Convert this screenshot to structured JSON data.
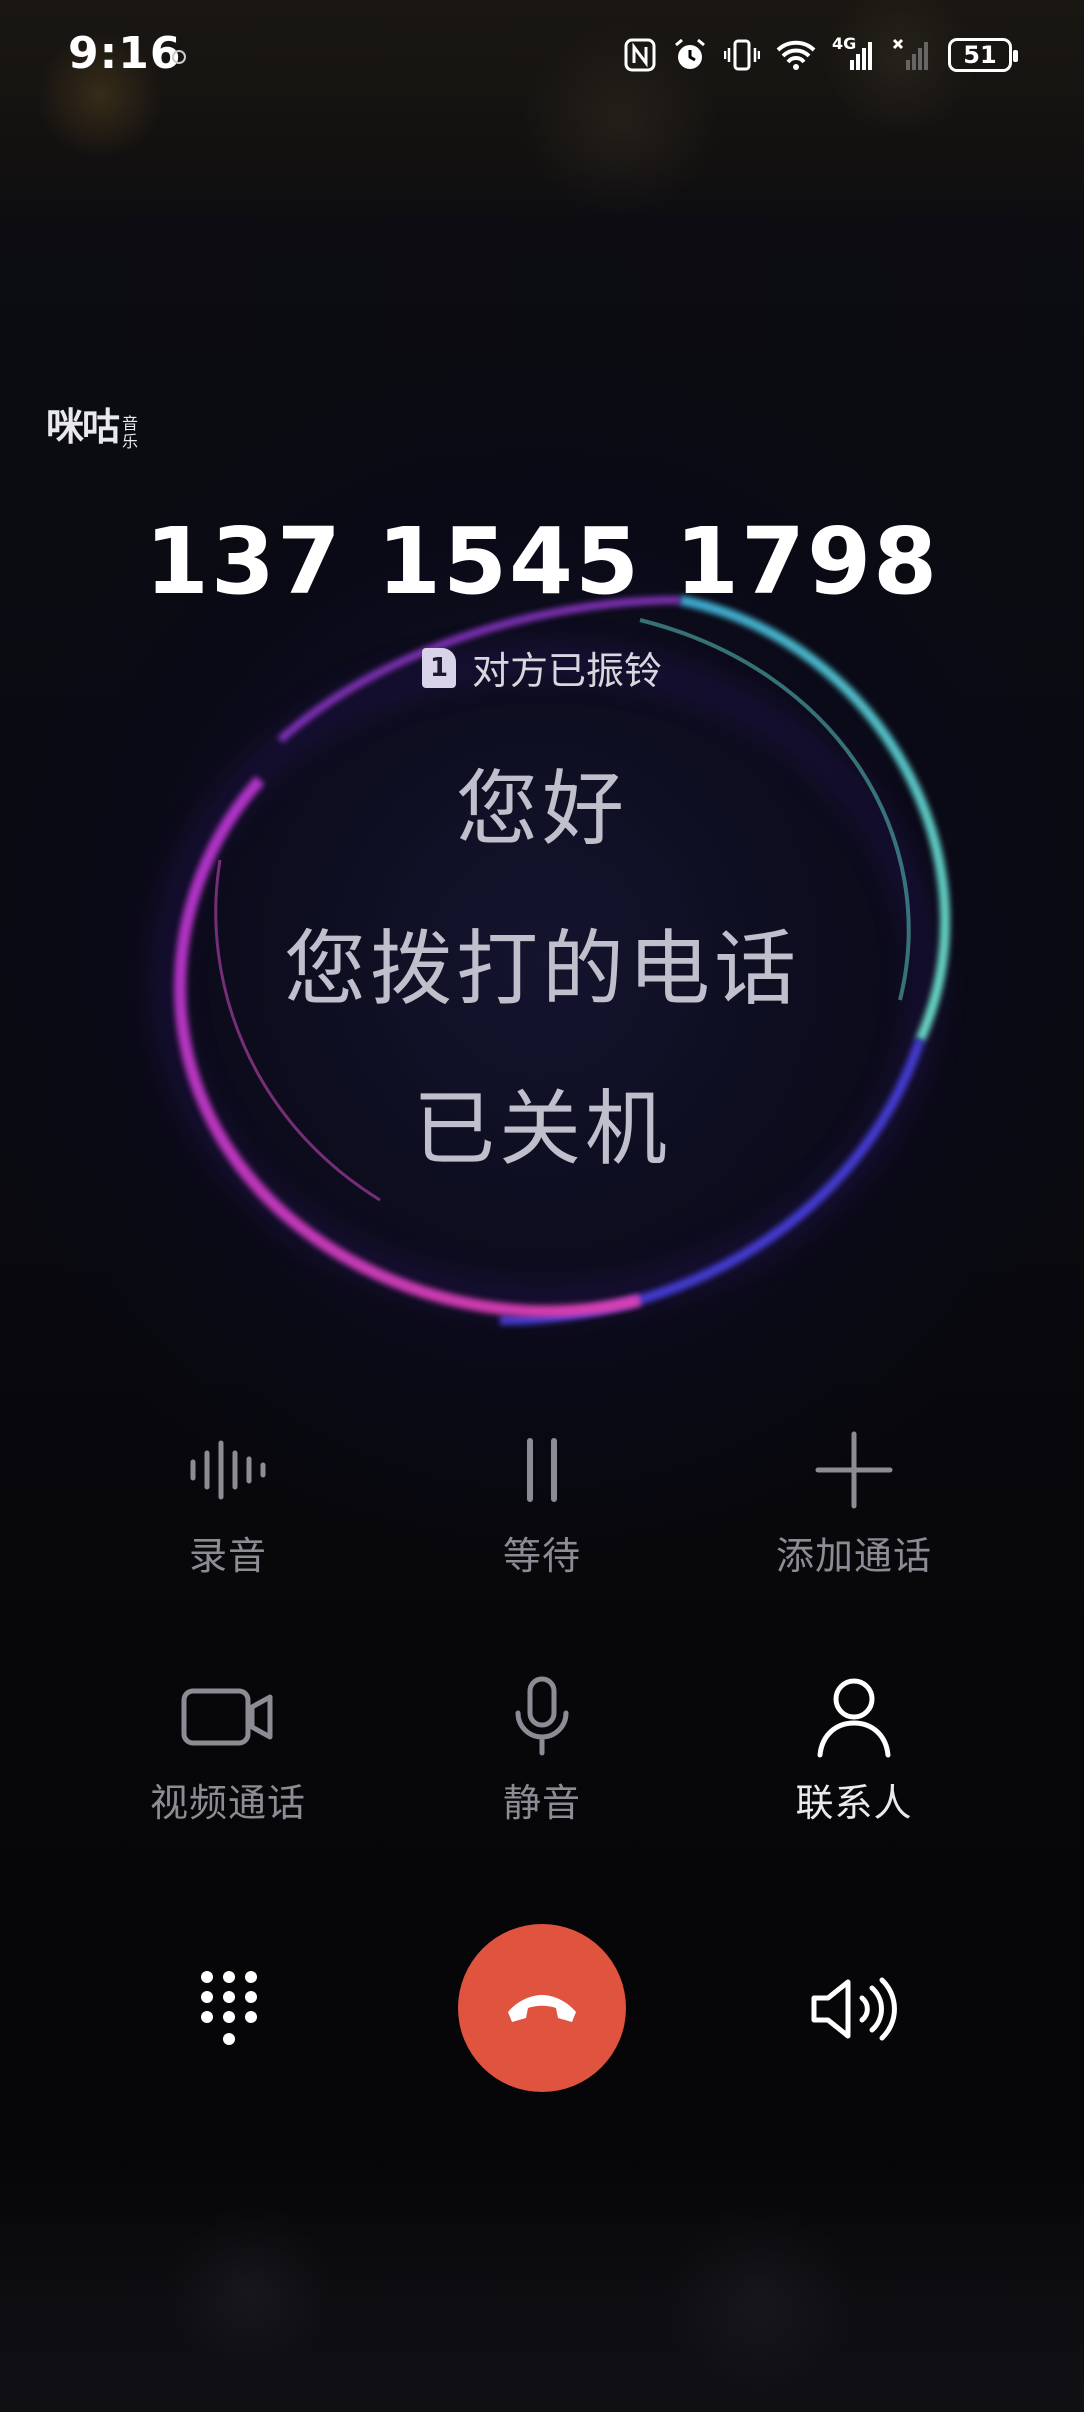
{
  "status_bar": {
    "time": "9:16",
    "network": "4G",
    "battery": "51",
    "icons": [
      "nfc-icon",
      "alarm-icon",
      "vibrate-icon",
      "wifi-icon",
      "signal-4g-icon",
      "signal-no-service-icon",
      "battery-icon"
    ]
  },
  "logo": {
    "main": "咪咕",
    "sub": "音乐"
  },
  "call": {
    "number": "137 1545 1798",
    "sim": "1",
    "status": "对方已振铃"
  },
  "message_lines": [
    "您好",
    "您拨打的电话",
    "已关机"
  ],
  "controls": {
    "record": {
      "label": "录音",
      "icon": "waveform-icon"
    },
    "hold": {
      "label": "等待",
      "icon": "pause-icon"
    },
    "add_call": {
      "label": "添加通话",
      "icon": "plus-icon"
    },
    "video_call": {
      "label": "视频通话",
      "icon": "video-camera-icon"
    },
    "mute": {
      "label": "静音",
      "icon": "microphone-icon"
    },
    "contacts": {
      "label": "联系人",
      "icon": "person-icon"
    }
  },
  "bottom": {
    "keypad_icon": "dialpad-icon",
    "end_call_icon": "hang-up-icon",
    "speaker_icon": "speaker-icon"
  },
  "colors": {
    "end_call": "#e0533f",
    "ring_magenta": "#c13ad8",
    "ring_cyan": "#5fd8d0",
    "ring_blue": "#4a3fe0"
  }
}
